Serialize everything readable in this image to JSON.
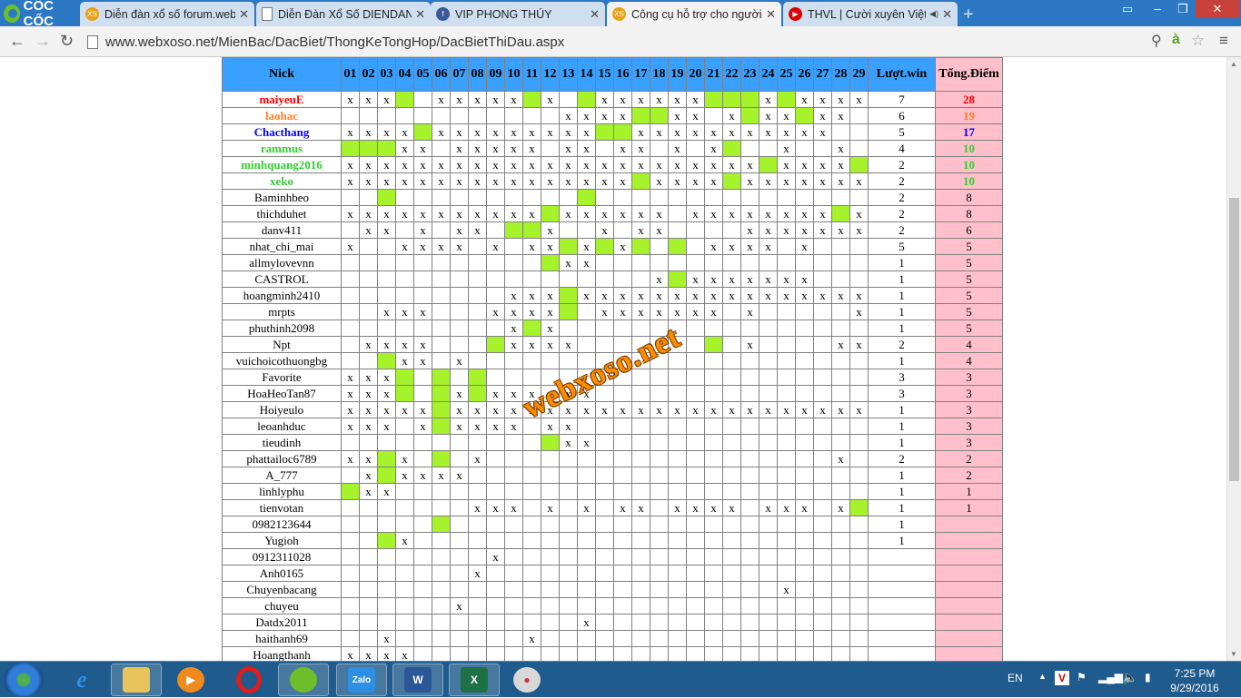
{
  "browser": {
    "logo_text": "CỐC CỐC",
    "tabs": [
      {
        "title": "Diễn đàn xổ số forum.web",
        "fav_color": "#e8a21a",
        "fav_text": "XS"
      },
      {
        "title": "Diễn Đàn Xổ Số DIENDAN",
        "fav_color": "#ffffff",
        "fav_text": ""
      },
      {
        "title": "VIP PHONG THỦY",
        "fav_color": "#3b5998",
        "fav_text": "f"
      },
      {
        "title": "Công cụ hỗ trợ cho người",
        "fav_color": "#e8a21a",
        "fav_text": "XS"
      },
      {
        "title": "THVL | Cười xuyên Việt",
        "fav_color": "#e00000",
        "fav_text": "▶"
      }
    ],
    "url": "www.webxoso.net/MienBac/DacBiet/ThongKeTongHop/DacBietThiDau.aspx"
  },
  "table": {
    "header_nick": "Nick",
    "days": [
      "01",
      "02",
      "03",
      "04",
      "05",
      "06",
      "07",
      "08",
      "09",
      "10",
      "11",
      "12",
      "13",
      "14",
      "15",
      "16",
      "17",
      "18",
      "19",
      "20",
      "21",
      "22",
      "23",
      "24",
      "25",
      "26",
      "27",
      "28",
      "29"
    ],
    "header_wins": "Lượt.win",
    "header_points": "Tổng.Điểm",
    "rows": [
      {
        "nick": "maiyeuE",
        "color": "#ff0000",
        "bold": true,
        "cells": "xxxG.xxxxxGx.GxxxxxxGGGxGxxxx",
        "wins": "7",
        "points": "28"
      },
      {
        "nick": "laohac",
        "color": "#ff7f27",
        "bold": true,
        "cells": "............xxxxGGxx.xGxxGxx.",
        "wins": "6",
        "points": "19"
      },
      {
        "nick": "Chacthang",
        "color": "#0000ff",
        "bold": true,
        "cells": "xxxxGxxxxxxxxxGGxxxxxxxxxxx..",
        "wins": "5",
        "points": "17"
      },
      {
        "nick": "rammus",
        "color": "#33cc33",
        "bold": true,
        "cells": "GGGxx.xxxxx.xx.xx.x.xG..x..x.",
        "wins": "4",
        "points": "10"
      },
      {
        "nick": "minhquang2016",
        "color": "#33cc33",
        "bold": true,
        "cells": "xxxxxxxxxxxxxxxxxxxxxxxGxxxxG",
        "wins": "2",
        "points": "10"
      },
      {
        "nick": "xeko",
        "color": "#33cc33",
        "bold": true,
        "cells": "xxxxxxxxxxxxxxxxGxxxxGxxxxxxx",
        "wins": "2",
        "points": "10"
      },
      {
        "nick": "Baminhbeo",
        "color": "#000000",
        "bold": false,
        "cells": "..G..........G...............",
        "wins": "2",
        "points": "8"
      },
      {
        "nick": "thichduhet",
        "color": "#000000",
        "bold": false,
        "cells": "xxxxxxxxxxxGxxxxxx.xxxxxxxxGx",
        "wins": "2",
        "points": "8"
      },
      {
        "nick": "danv411",
        "color": "#000000",
        "bold": false,
        "cells": ".xx.x.xx.GGx..x.xx....xxxxxxx",
        "wins": "2",
        "points": "6"
      },
      {
        "nick": "nhat_chi_mai",
        "color": "#000000",
        "bold": false,
        "cells": "x..xxxx.x.xxGxGxG.G.xxxx.x...",
        "wins": "5",
        "points": "5"
      },
      {
        "nick": "allmylovevnn",
        "color": "#000000",
        "bold": false,
        "cells": "...........Gxx...............",
        "wins": "1",
        "points": "5"
      },
      {
        "nick": "CASTROL",
        "color": "#000000",
        "bold": false,
        "cells": ".................xGxxxxxxx...",
        "wins": "1",
        "points": "5"
      },
      {
        "nick": "hoangminh2410",
        "color": "#000000",
        "bold": false,
        "cells": ".........xxxGxxxxxxxxxxxxxxxx",
        "wins": "1",
        "points": "5"
      },
      {
        "nick": "mrpts",
        "color": "#000000",
        "bold": false,
        "cells": "..xxx...xxxxG.xxxxxxx.x.....x",
        "wins": "1",
        "points": "5"
      },
      {
        "nick": "phuthinh2098",
        "color": "#000000",
        "bold": false,
        "cells": ".........xGx.................",
        "wins": "1",
        "points": "5"
      },
      {
        "nick": "Npt",
        "color": "#000000",
        "bold": false,
        "cells": ".xxxx...Gxxxx.......G.x....xx",
        "wins": "2",
        "points": "4"
      },
      {
        "nick": "vuichoicothuongbg",
        "color": "#000000",
        "bold": false,
        "cells": "..Gxx.x......................",
        "wins": "1",
        "points": "4"
      },
      {
        "nick": "Favorite",
        "color": "#000000",
        "bold": false,
        "cells": "xxxG.G.G.....................",
        "wins": "3",
        "points": "3"
      },
      {
        "nick": "HoaHeoTan87",
        "color": "#000000",
        "bold": false,
        "cells": "xxxG.GxGxxxxxx...............",
        "wins": "3",
        "points": "3"
      },
      {
        "nick": "Hoiyeulo",
        "color": "#000000",
        "bold": false,
        "cells": "xxxxxGxxxxxxxxxxxxxxxxxxxxxxx",
        "wins": "1",
        "points": "3"
      },
      {
        "nick": "leoanhduc",
        "color": "#000000",
        "bold": false,
        "cells": "xxx.xGxxxx.xx................",
        "wins": "1",
        "points": "3"
      },
      {
        "nick": "tieudinh",
        "color": "#000000",
        "bold": false,
        "cells": "...........Gxx...............",
        "wins": "1",
        "points": "3"
      },
      {
        "nick": "phattailoc6789",
        "color": "#000000",
        "bold": false,
        "cells": "xxGx.G.x...................x.",
        "wins": "2",
        "points": "2"
      },
      {
        "nick": "A_777",
        "color": "#000000",
        "bold": false,
        "cells": ".xGxxxx......................",
        "wins": "1",
        "points": "2"
      },
      {
        "nick": "linhlyphu",
        "color": "#000000",
        "bold": false,
        "cells": "Gxx..........................",
        "wins": "1",
        "points": "1"
      },
      {
        "nick": "tienvotan",
        "color": "#000000",
        "bold": false,
        "cells": ".......xxx.x.x.xx.xxxx.xxx.xG",
        "wins": "1",
        "points": "1"
      },
      {
        "nick": "0982123644",
        "color": "#000000",
        "bold": false,
        "cells": ".....G.......................",
        "wins": "1",
        "points": ""
      },
      {
        "nick": "Yugioh",
        "color": "#000000",
        "bold": false,
        "cells": "..Gx.........................",
        "wins": "1",
        "points": ""
      },
      {
        "nick": "0912311028",
        "color": "#000000",
        "bold": false,
        "cells": "........x....................",
        "wins": "",
        "points": ""
      },
      {
        "nick": "Anh0165",
        "color": "#000000",
        "bold": false,
        "cells": ".......x.....................",
        "wins": "",
        "points": ""
      },
      {
        "nick": "Chuyenbacang",
        "color": "#000000",
        "bold": false,
        "cells": "........................x....",
        "wins": "",
        "points": ""
      },
      {
        "nick": "chuyeu",
        "color": "#000000",
        "bold": false,
        "cells": "......x......................",
        "wins": "",
        "points": ""
      },
      {
        "nick": "Datdx2011",
        "color": "#000000",
        "bold": false,
        "cells": ".............x...............",
        "wins": "",
        "points": ""
      },
      {
        "nick": "haithanh69",
        "color": "#000000",
        "bold": false,
        "cells": "..x.......x..................",
        "wins": "",
        "points": ""
      },
      {
        "nick": "Hoangthanh",
        "color": "#000000",
        "bold": false,
        "cells": "xxxx.........................",
        "wins": "",
        "points": ""
      }
    ],
    "hit_color": "#a6f22b",
    "points_bg": "#ffc0cb",
    "header_bg": "#3aa0ff"
  },
  "watermark": "webxoso.net",
  "taskbar": {
    "lang": "EN",
    "time": "7:25 PM",
    "date": "9/29/2016"
  }
}
